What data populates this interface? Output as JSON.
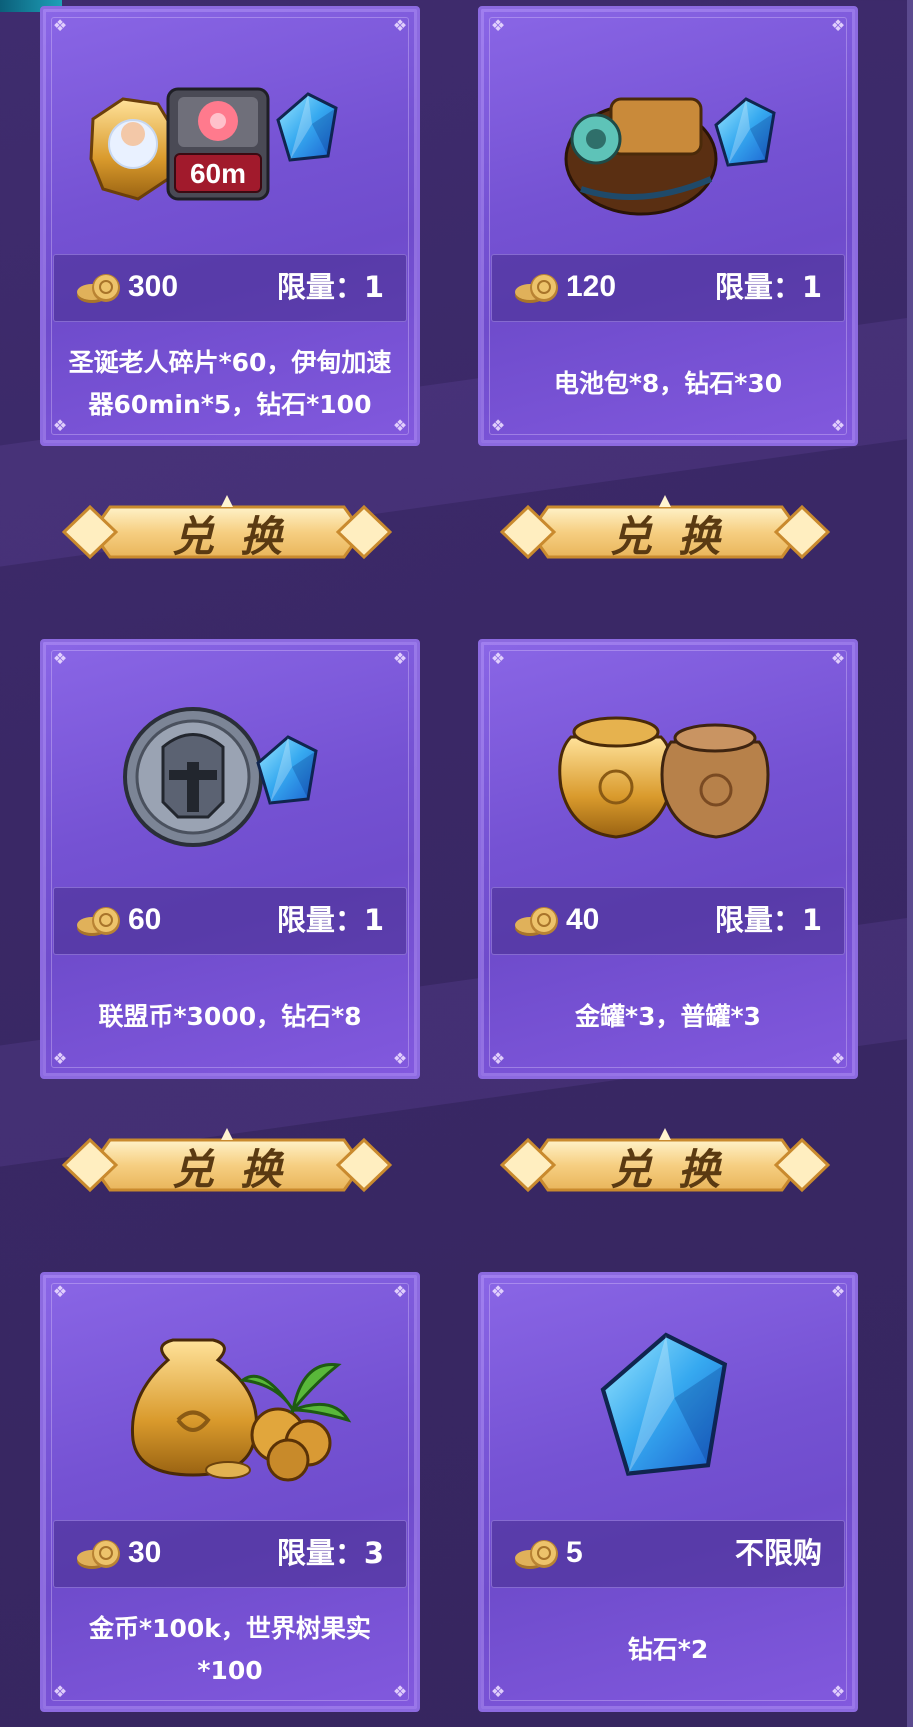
{
  "colors": {
    "background": "#3a2866",
    "card": "#7552d3",
    "button_gold": "#f4cd7e",
    "button_text": "#5a3a12"
  },
  "cards": [
    {
      "price": "300",
      "limit": "限量：1",
      "description": "圣诞老人碎片*60，伊甸加速器60min*5，钻石*100",
      "icon": "santa-shard-accelerator-diamond-icon",
      "badge": "60m"
    },
    {
      "price": "120",
      "limit": "限量：1",
      "description": "电池包*8，钻石*30",
      "icon": "battery-pack-diamond-icon"
    },
    {
      "price": "60",
      "limit": "限量：1",
      "description": "联盟币*3000，钻石*8",
      "icon": "alliance-coin-diamond-icon"
    },
    {
      "price": "40",
      "limit": "限量：1",
      "description": "金罐*3，普罐*3",
      "icon": "gold-jar-normal-jar-icon"
    },
    {
      "price": "30",
      "limit": "限量：3",
      "description": "金币*100k，世界树果实*100",
      "icon": "gold-coin-bag-world-tree-fruit-icon"
    },
    {
      "price": "5",
      "limit": "不限购",
      "description": "钻石*2",
      "icon": "diamond-icon"
    }
  ],
  "exchange_label": "兑换"
}
